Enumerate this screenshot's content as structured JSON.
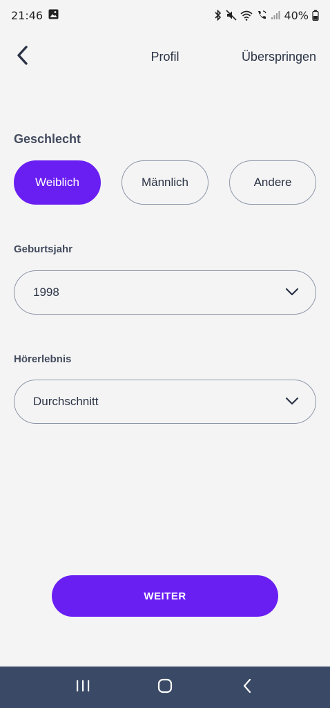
{
  "status_bar": {
    "time": "21:46",
    "battery_percent": "40%",
    "icons": [
      "image-icon",
      "bluetooth-icon",
      "mute-icon",
      "wifi-icon",
      "wifi-call-icon",
      "signal-icon",
      "battery-icon"
    ]
  },
  "header": {
    "title": "Profil",
    "skip_label": "Überspringen",
    "back_icon": "chevron-left-icon"
  },
  "gender": {
    "label": "Geschlecht",
    "options": [
      "Weiblich",
      "Männlich",
      "Andere"
    ],
    "selected": "Weiblich"
  },
  "birth_year": {
    "label": "Geburtsjahr",
    "value": "1998"
  },
  "hearing": {
    "label": "Hörerlebnis",
    "value": "Durchschnitt"
  },
  "actions": {
    "next_label": "WEITER"
  },
  "colors": {
    "accent": "#6a1ff2",
    "text": "#2b3346",
    "background": "#f4f4f4",
    "system_nav": "#3a4a66"
  },
  "system_nav": {
    "icons": [
      "recent-apps-icon",
      "home-icon",
      "back-icon"
    ]
  }
}
